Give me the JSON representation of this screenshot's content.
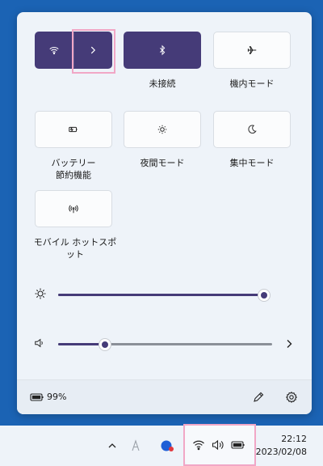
{
  "quick_settings": {
    "tiles": {
      "bluetooth_label": "未接続",
      "airplane_label": "機内モード",
      "battery_saver_label_1": "バッテリー",
      "battery_saver_label_2": "節約機能",
      "night_light_label": "夜間モード",
      "focus_label": "集中モード",
      "hotspot_label_1": "モバイル ホットスポ",
      "hotspot_label_2": "ット"
    },
    "brightness_level": 1.0,
    "volume_level": 0.22,
    "battery_text": "99%"
  },
  "taskbar": {
    "time": "22:12",
    "date": "2023/02/08"
  },
  "colors": {
    "accent": "#453b78",
    "desktop": "#1b63b4",
    "panel": "#eef3f9",
    "highlight": "#f1a7c6"
  }
}
